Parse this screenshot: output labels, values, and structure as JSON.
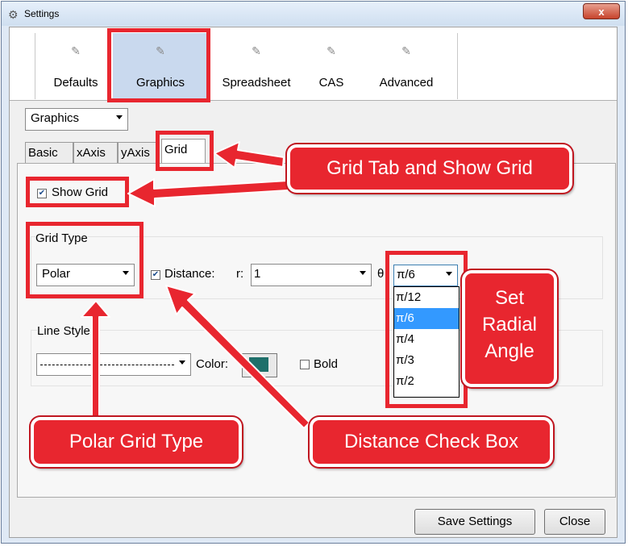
{
  "window": {
    "title": "Settings",
    "close_glyph": "x"
  },
  "toolbar": {
    "items": [
      {
        "label": "Defaults",
        "icon": "settings-page-icon"
      },
      {
        "label": "Graphics",
        "icon": "settings-page-icon",
        "selected": true
      },
      {
        "label": "Spreadsheet",
        "icon": "settings-page-icon"
      },
      {
        "label": "CAS",
        "icon": "settings-page-icon"
      },
      {
        "label": "Advanced",
        "icon": "settings-page-icon"
      }
    ]
  },
  "view_select": {
    "value": "Graphics"
  },
  "tabs": [
    "Basic",
    "xAxis",
    "yAxis",
    "Grid"
  ],
  "selected_tab": "Grid",
  "grid": {
    "show_grid_label": "Show Grid",
    "show_grid_checked": true,
    "grid_type_title": "Grid Type",
    "grid_type_value": "Polar",
    "distance_label": "Distance:",
    "distance_checked": true,
    "r_label": "r:",
    "r_value": "1",
    "theta_label": "θ",
    "theta_value": "π/6",
    "theta_options": [
      "π/12",
      "π/6",
      "π/4",
      "π/3",
      "π/2"
    ],
    "theta_selected_index": 1
  },
  "line_style": {
    "title": "Line Style",
    "color_label": "Color:",
    "color_hex": "#1f6f6a",
    "bold_label": "Bold",
    "bold_checked": false
  },
  "footer": {
    "save_label": "Save Settings",
    "close_label": "Close"
  },
  "annotations": {
    "grid_tab": "Grid Tab and Show Grid",
    "radial_line1": "Set",
    "radial_line2": "Radial",
    "radial_line3": "Angle",
    "polar": "Polar Grid Type",
    "distance": "Distance Check Box"
  },
  "colors": {
    "accent_red": "#e8262f",
    "selection_blue": "#3399ff",
    "toolbar_selected": "#c9d9ee"
  }
}
